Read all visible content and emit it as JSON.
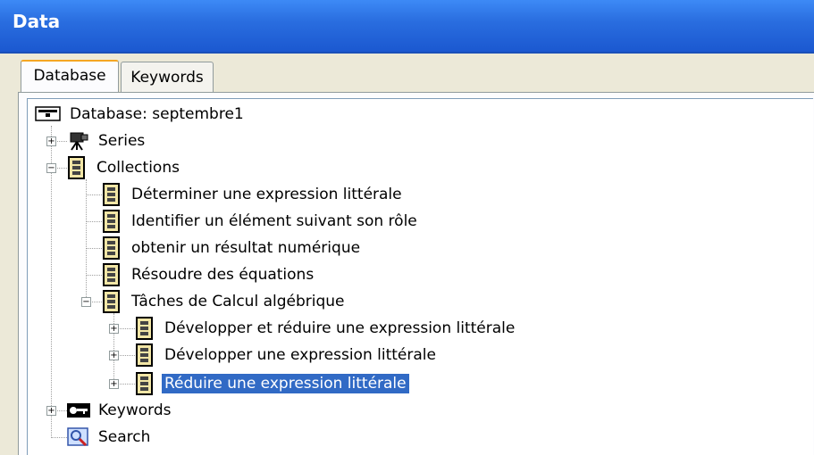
{
  "window": {
    "title": "Data"
  },
  "tabs": [
    {
      "label": "Database",
      "active": true
    },
    {
      "label": "Keywords",
      "active": false
    }
  ],
  "tree": {
    "root": "Database: septembre1",
    "series": "Series",
    "collections": "Collections",
    "collection_items": [
      "Déterminer une expression littérale",
      "Identifier un élément suivant son rôle",
      "obtenir un résultat numérique",
      "Résoudre des équations",
      "Tâches de Calcul algébrique"
    ],
    "subitems": [
      "Développer et réduire une expression littérale",
      "Développer une expression littérale",
      "Réduire une expression littérale"
    ],
    "keywords": "Keywords",
    "search": "Search",
    "selected": "Réduire une expression littérale"
  },
  "colors": {
    "titlebar": "#2a6ee0",
    "selection": "#316ac5",
    "tab_accent": "#f5a623"
  }
}
